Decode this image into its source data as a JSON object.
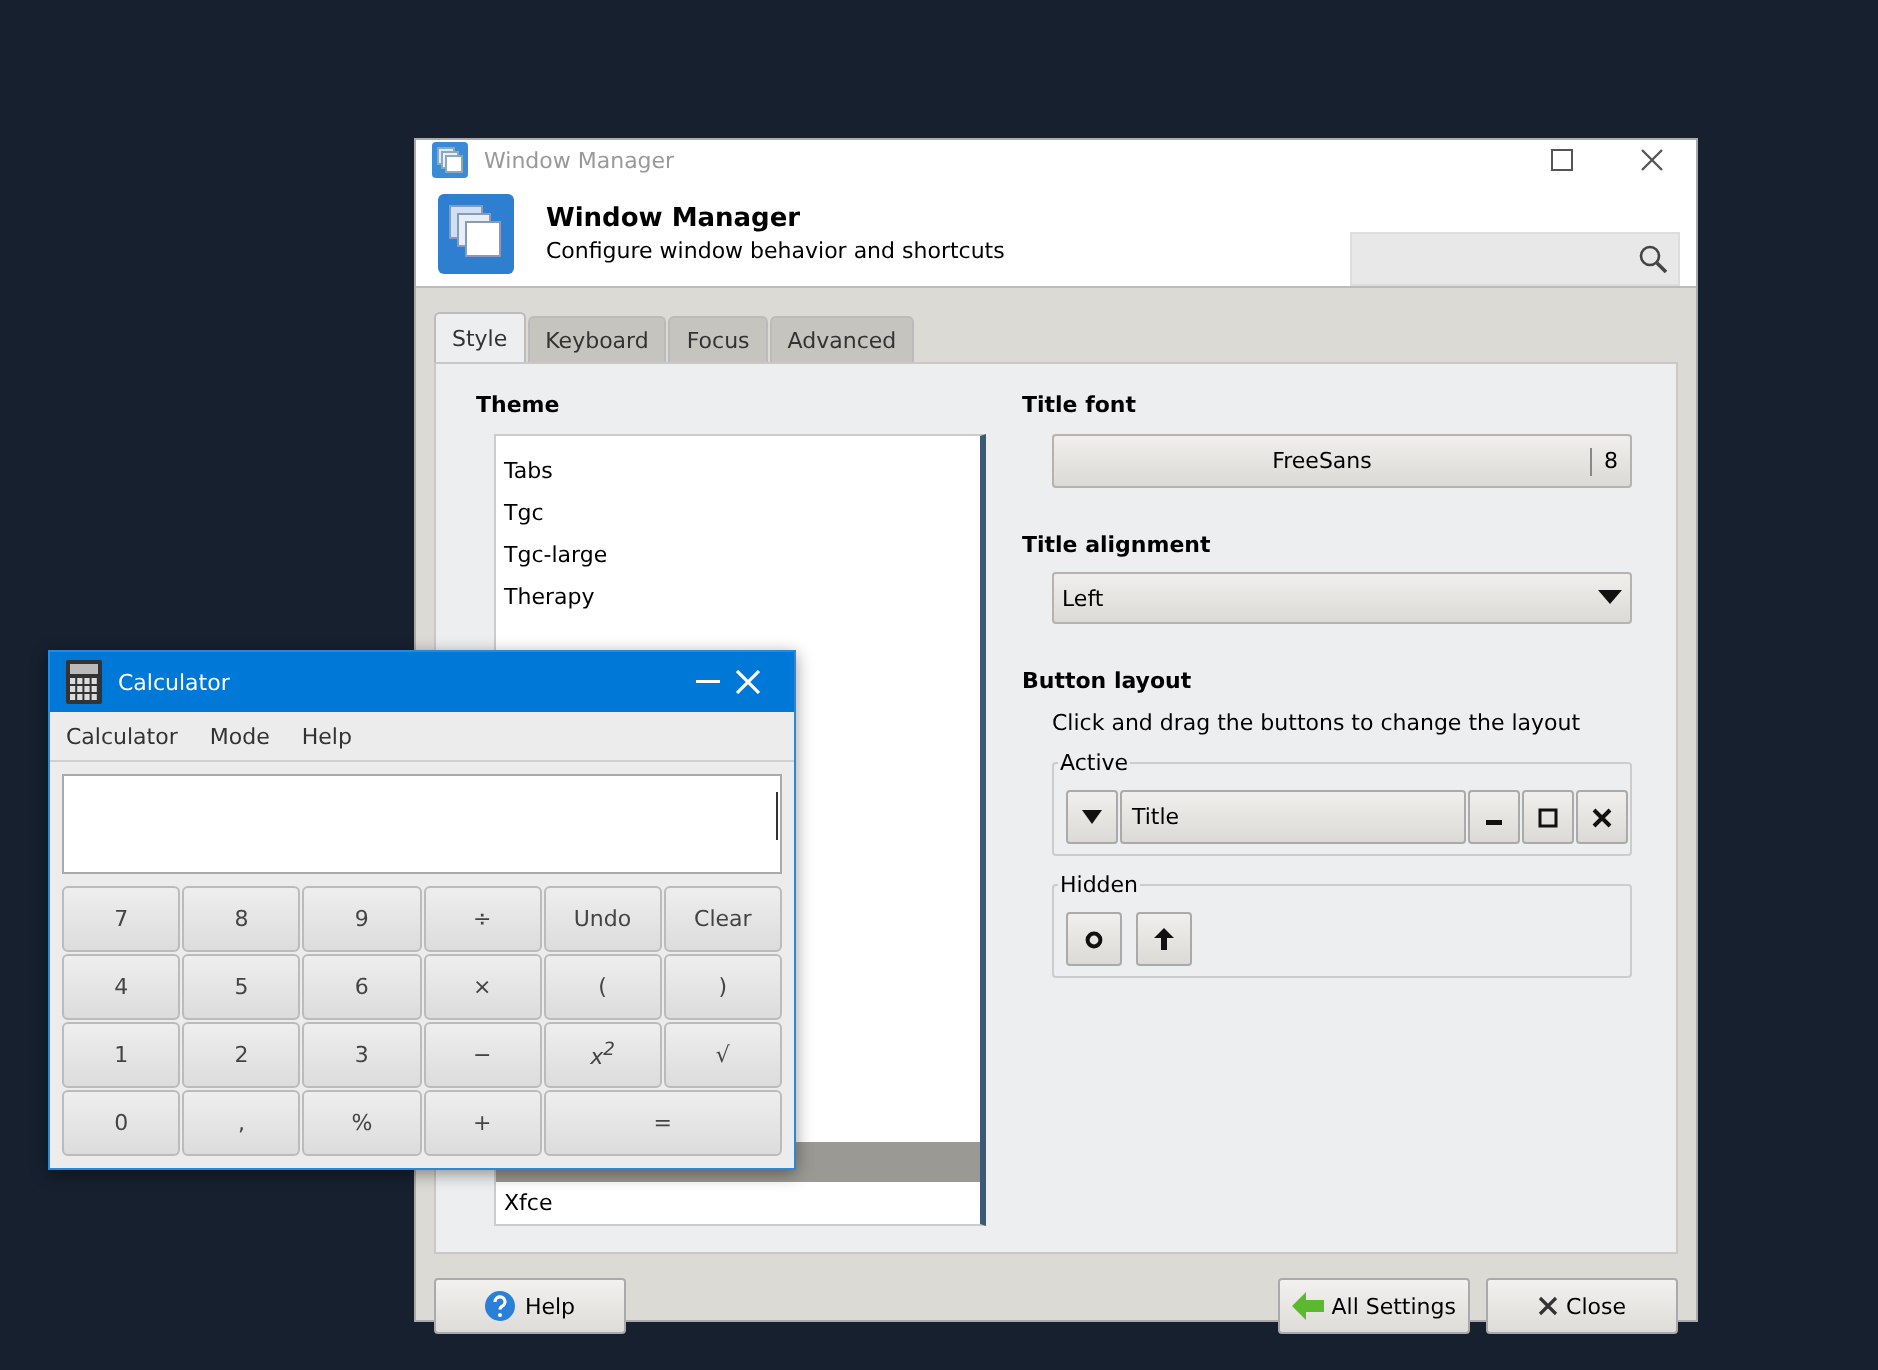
{
  "window": {
    "title": "Window Manager",
    "header_title": "Window Manager",
    "header_subtitle": "Configure window behavior and shortcuts"
  },
  "tabs": [
    {
      "label": "Style",
      "selected": true
    },
    {
      "label": "Keyboard",
      "selected": false
    },
    {
      "label": "Focus",
      "selected": false
    },
    {
      "label": "Advanced",
      "selected": false
    }
  ],
  "theme": {
    "label": "Theme",
    "items": [
      {
        "label": "Tabs",
        "selected": false
      },
      {
        "label": "Tgc",
        "selected": false
      },
      {
        "label": "Tgc-large",
        "selected": false
      },
      {
        "label": "Therapy",
        "selected": false
      },
      {
        "selected": true
      },
      {
        "label": "Xfce",
        "selected": false
      }
    ]
  },
  "title_font": {
    "label": "Title font",
    "font": "FreeSans",
    "size": "8"
  },
  "title_alignment": {
    "label": "Title alignment",
    "value": "Left"
  },
  "button_layout": {
    "label": "Button layout",
    "hint": "Click and drag the buttons to change the layout",
    "active_label": "Active",
    "active": [
      {
        "kind": "menu"
      },
      {
        "kind": "title",
        "label": "Title"
      },
      {
        "kind": "minimize"
      },
      {
        "kind": "maximize"
      },
      {
        "kind": "close"
      }
    ],
    "hidden_label": "Hidden",
    "hidden": [
      {
        "kind": "stick"
      },
      {
        "kind": "shade"
      }
    ]
  },
  "footer": {
    "help": "Help",
    "all_settings": "All Settings",
    "close": "Close"
  },
  "calculator": {
    "title": "Calculator",
    "menu": [
      "Calculator",
      "Mode",
      "Help"
    ],
    "keys": [
      {
        "label": "7"
      },
      {
        "label": "8"
      },
      {
        "label": "9"
      },
      {
        "label": "÷"
      },
      {
        "label": "Undo"
      },
      {
        "label": "Clear"
      },
      {
        "label": "4"
      },
      {
        "label": "5"
      },
      {
        "label": "6"
      },
      {
        "label": "×"
      },
      {
        "label": "("
      },
      {
        "label": ")"
      },
      {
        "label": "1"
      },
      {
        "label": "2"
      },
      {
        "label": "3"
      },
      {
        "label": "−"
      },
      {
        "label": "x$^{2}$",
        "kind": "power"
      },
      {
        "label": "√"
      },
      {
        "label": "0"
      },
      {
        "label": ","
      },
      {
        "label": "%"
      },
      {
        "label": "+"
      },
      {
        "label": "=",
        "kind": "wide"
      }
    ]
  }
}
